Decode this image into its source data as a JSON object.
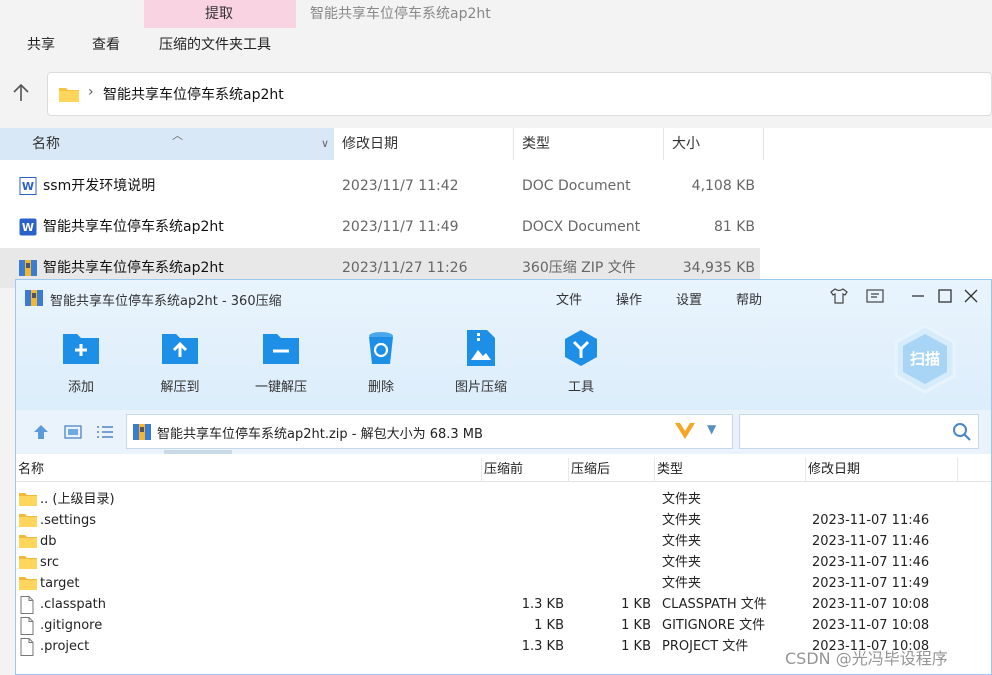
{
  "explorer": {
    "ribbon_tab_active": "提取",
    "window_title": "智能共享车位停车系统ap2ht",
    "ribbon": [
      "共享",
      "查看",
      "压缩的文件夹工具"
    ],
    "address_path": "智能共享车位停车系统ap2ht",
    "columns": [
      "名称",
      "修改日期",
      "类型",
      "大小"
    ],
    "files": [
      {
        "name": "ssm开发环境说明",
        "date": "2023/11/7 11:42",
        "type": "DOC Document",
        "size": "4,108 KB",
        "icon": "word-doc-icon"
      },
      {
        "name": "智能共享车位停车系统ap2ht",
        "date": "2023/11/7 11:49",
        "type": "DOCX Document",
        "size": "81 KB",
        "icon": "word-docx-icon"
      },
      {
        "name": "智能共享车位停车系统ap2ht",
        "date": "2023/11/27 11:26",
        "type": "360压缩 ZIP 文件",
        "size": "34,935 KB",
        "icon": "zip-archive-icon"
      }
    ]
  },
  "compress_window": {
    "title": "智能共享车位停车系统ap2ht - 360压缩",
    "menu": [
      "文件",
      "操作",
      "设置",
      "帮助"
    ],
    "toolbar": [
      {
        "label": "添加",
        "icon": "add-icon"
      },
      {
        "label": "解压到",
        "icon": "extract-to-icon"
      },
      {
        "label": "一键解压",
        "icon": "one-click-extract-icon"
      },
      {
        "label": "删除",
        "icon": "delete-icon"
      },
      {
        "label": "图片压缩",
        "icon": "image-compress-icon"
      },
      {
        "label": "工具",
        "icon": "tools-icon"
      }
    ],
    "scan_label": "扫描",
    "path_text": "智能共享车位停车系统ap2ht.zip - 解包大小为 68.3 MB",
    "search_placeholder": "",
    "columns": [
      "名称",
      "压缩前",
      "压缩后",
      "类型",
      "修改日期"
    ],
    "entries": [
      {
        "name": ".. (上级目录)",
        "before": "",
        "after": "",
        "type": "文件夹",
        "date": "",
        "icon": "folder-icon"
      },
      {
        "name": ".settings",
        "before": "",
        "after": "",
        "type": "文件夹",
        "date": "2023-11-07 11:46",
        "icon": "folder-icon"
      },
      {
        "name": "db",
        "before": "",
        "after": "",
        "type": "文件夹",
        "date": "2023-11-07 11:46",
        "icon": "folder-icon"
      },
      {
        "name": "src",
        "before": "",
        "after": "",
        "type": "文件夹",
        "date": "2023-11-07 11:46",
        "icon": "folder-icon"
      },
      {
        "name": "target",
        "before": "",
        "after": "",
        "type": "文件夹",
        "date": "2023-11-07 11:49",
        "icon": "folder-icon"
      },
      {
        "name": ".classpath",
        "before": "1.3 KB",
        "after": "1 KB",
        "type": "CLASSPATH 文件",
        "date": "2023-11-07 10:08",
        "icon": "file-icon"
      },
      {
        "name": ".gitignore",
        "before": "1 KB",
        "after": "1 KB",
        "type": "GITIGNORE 文件",
        "date": "2023-11-07 10:08",
        "icon": "file-icon"
      },
      {
        "name": ".project",
        "before": "1.3 KB",
        "after": "1 KB",
        "type": "PROJECT 文件",
        "date": "2023-11-07 10:08",
        "icon": "file-icon"
      }
    ]
  },
  "watermark": "CSDN @光冯毕设程序",
  "colors": {
    "accent_blue": "#1e8fe6",
    "folder_yellow": "#f5c342",
    "selection_bg": "#d9e8f7"
  }
}
